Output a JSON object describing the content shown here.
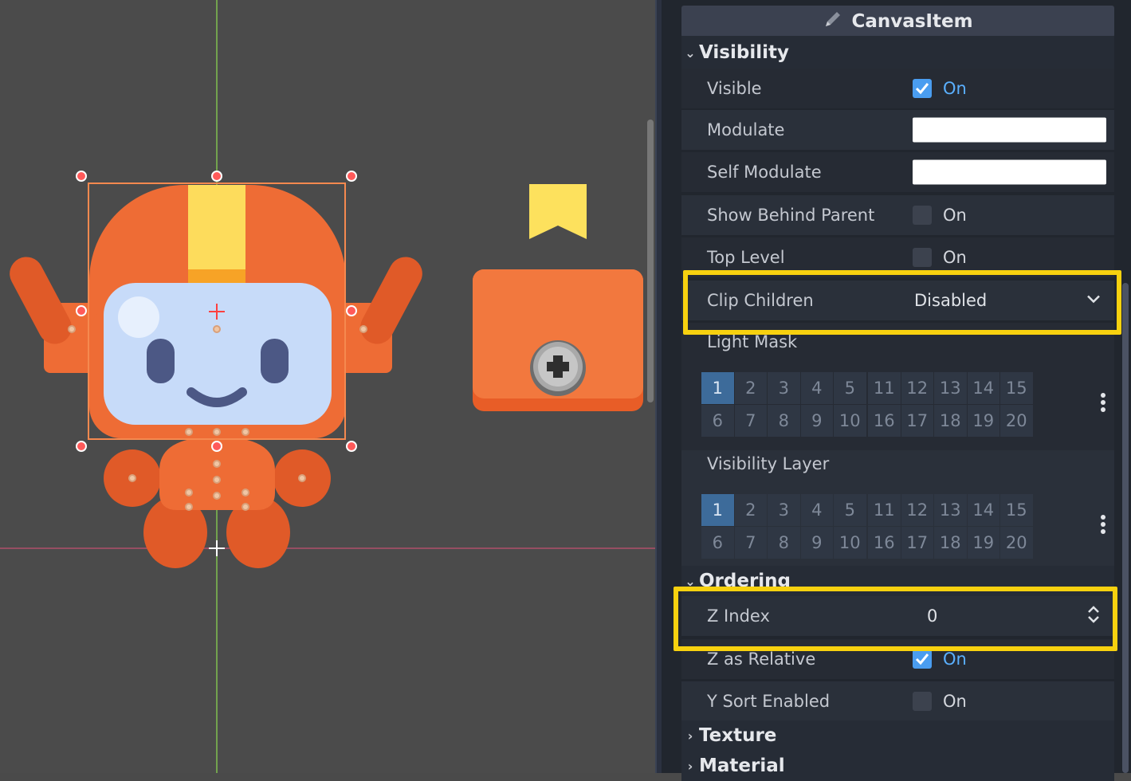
{
  "viewport": {
    "scene_name": "",
    "colors": {
      "background": "#4b4b4b",
      "robot_orange": "#ee6c35",
      "face": "#c7dbf9",
      "accent_yellow": "#fddc5c"
    }
  },
  "inspector": {
    "header_title": "CanvasItem",
    "header_icon": "pencil-icon",
    "sections": {
      "visibility": "Visibility",
      "ordering": "Ordering",
      "texture": "Texture",
      "material": "Material"
    },
    "properties": {
      "visible": {
        "label": "Visible",
        "value": "On",
        "checked": true
      },
      "modulate": {
        "label": "Modulate",
        "color": "#ffffff"
      },
      "self_modulate": {
        "label": "Self Modulate",
        "color": "#ffffff"
      },
      "show_behind_parent": {
        "label": "Show Behind Parent",
        "value": "On",
        "checked": false
      },
      "top_level": {
        "label": "Top Level",
        "value": "On",
        "checked": false
      },
      "clip_children": {
        "label": "Clip Children",
        "value": "Disabled"
      },
      "light_mask": {
        "label": "Light Mask"
      },
      "visibility_layer": {
        "label": "Visibility Layer"
      },
      "z_index": {
        "label": "Z Index",
        "value": "0"
      },
      "z_as_relative": {
        "label": "Z as Relative",
        "value": "On",
        "checked": true
      },
      "y_sort_enabled": {
        "label": "Y Sort Enabled",
        "value": "On",
        "checked": false
      }
    },
    "layer_grid": {
      "left_top": [
        "1",
        "2",
        "3",
        "4",
        "5"
      ],
      "left_bottom": [
        "6",
        "7",
        "8",
        "9",
        "10"
      ],
      "right_top": [
        "11",
        "12",
        "13",
        "14",
        "15"
      ],
      "right_bottom": [
        "16",
        "17",
        "18",
        "19",
        "20"
      ],
      "selected": "1"
    },
    "highlight_color": "#f7d10f"
  }
}
